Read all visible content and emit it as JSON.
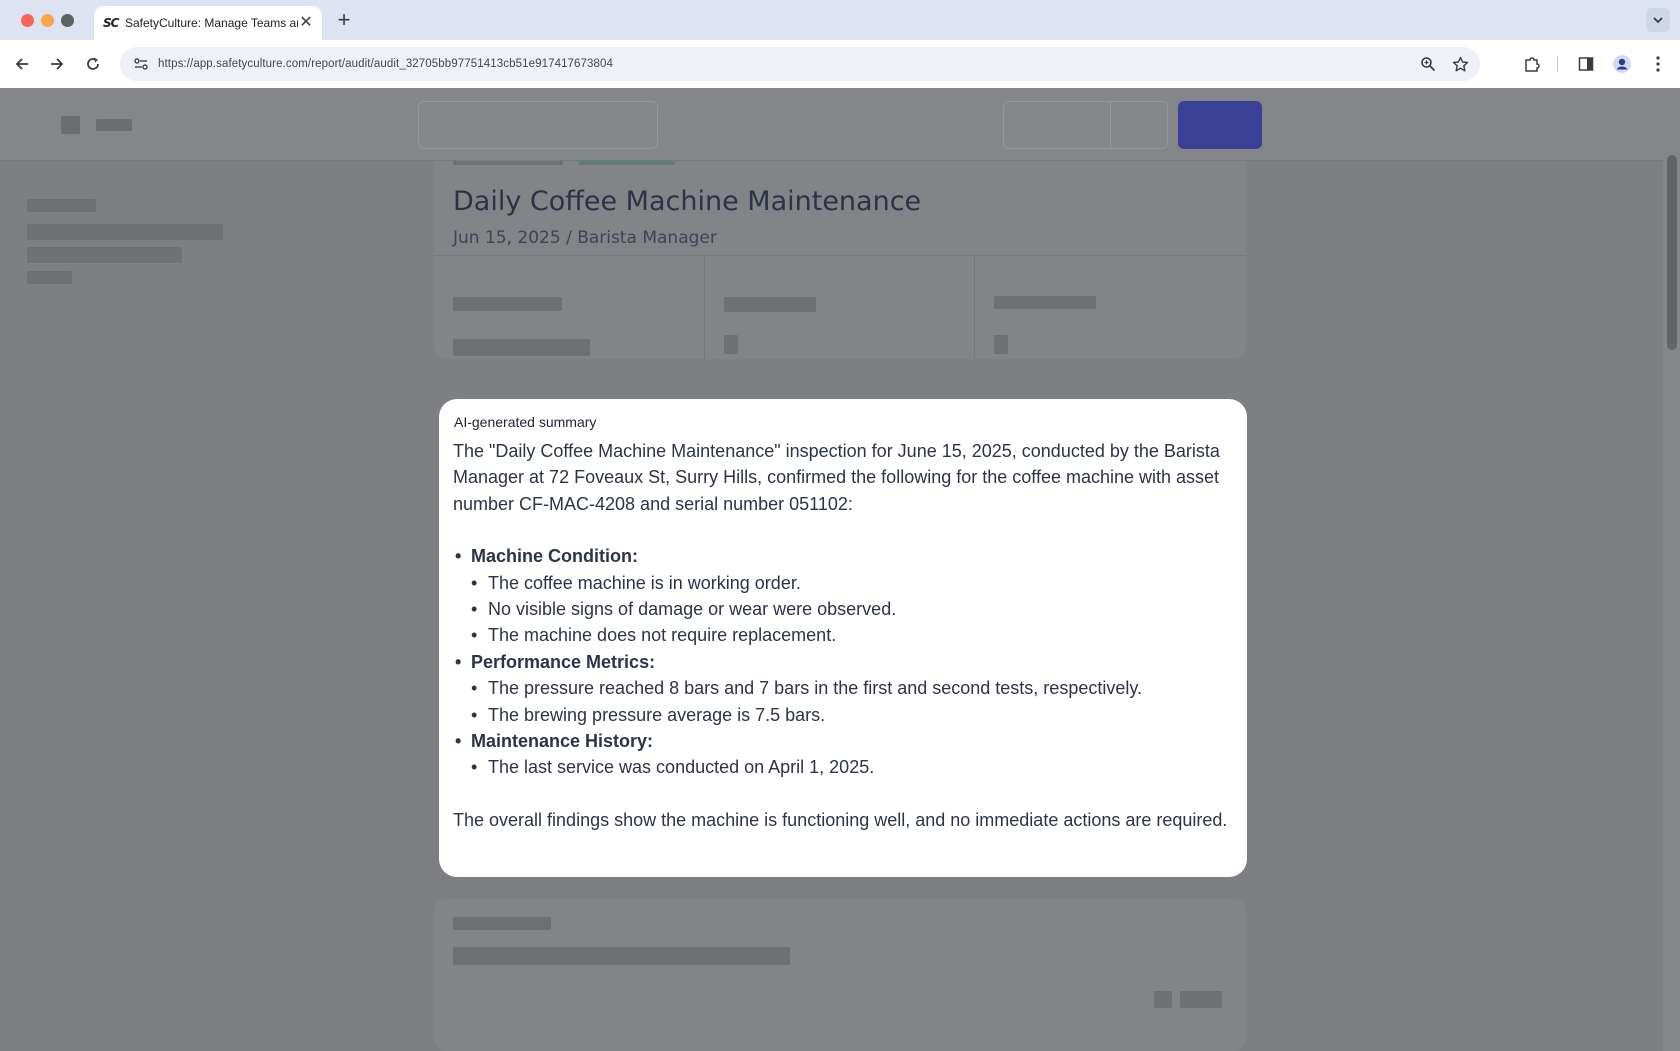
{
  "browser": {
    "tab_title": "SafetyCulture: Manage Teams and...",
    "tab_favicon": "SC",
    "close_glyph": "✕",
    "new_tab_glyph": "+",
    "url": "https://app.safetyculture.com/report/audit/audit_32705bb97751413cb51e917417673804"
  },
  "report": {
    "title": "Daily Coffee Machine Maintenance",
    "subtitle": "Jun 15, 2025 / Barista Manager"
  },
  "summary": {
    "label": "AI-generated summary",
    "intro": "The \"Daily Coffee Machine Maintenance\" inspection for June 15, 2025, conducted by the Barista Manager at 72 Foveaux St, Surry Hills, confirmed the following for the coffee machine with asset number CF-MAC-4208 and serial number 051102:",
    "sections": [
      {
        "heading": "Machine Condition:",
        "items": [
          "The coffee machine is in working order.",
          "No visible signs of damage or wear were observed.",
          "The machine does not require replacement."
        ]
      },
      {
        "heading": "Performance Metrics:",
        "items": [
          "The pressure reached 8 bars and 7 bars in the first and second tests, respectively.",
          "The brewing pressure average is 7.5 bars."
        ]
      },
      {
        "heading": "Maintenance History:",
        "items": [
          "The last service was conducted on April 1, 2025."
        ]
      }
    ],
    "conclusion": "The overall findings show the machine is functioning well, and no immediate actions are required."
  },
  "colors": {
    "overlay": "#7d7f82",
    "primary_button": "#3b3f96",
    "text": "#2d3448"
  }
}
